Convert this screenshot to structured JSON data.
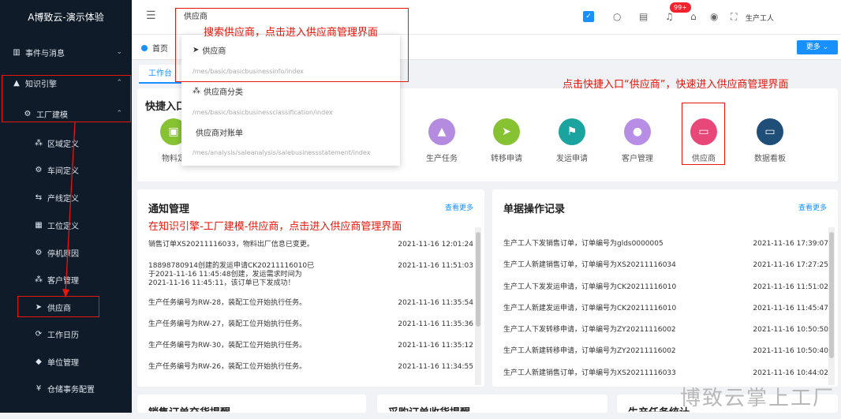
{
  "app": {
    "title": "A博致云-演示体验"
  },
  "sidebar": {
    "items": [
      {
        "label": "事件与消息",
        "icon": "chart-icon"
      },
      {
        "label": "知识引擎",
        "icon": "graduation-icon"
      },
      {
        "label": "工厂建模",
        "icon": "gear-icon"
      },
      {
        "label": "区域定义",
        "icon": "sitemap-icon"
      },
      {
        "label": "车间定义",
        "icon": "gear-icon"
      },
      {
        "label": "产线定义",
        "icon": "line-icon"
      },
      {
        "label": "工位定义",
        "icon": "grid-icon"
      },
      {
        "label": "停机原因",
        "icon": "gear-icon"
      },
      {
        "label": "客户管理",
        "icon": "sitemap-icon"
      },
      {
        "label": "供应商",
        "icon": "plane-icon"
      },
      {
        "label": "工作日历",
        "icon": "cycle-icon"
      },
      {
        "label": "单位管理",
        "icon": "badge-icon"
      },
      {
        "label": "仓储事务配置",
        "icon": "yen-icon"
      }
    ]
  },
  "topbar": {
    "search_value": "供应商",
    "badge": "99+",
    "user": "生产工人"
  },
  "tabbar": {
    "home": "首页",
    "more": "更多"
  },
  "subtab": "工作台",
  "dropdown": {
    "items": [
      {
        "label": "供应商",
        "path": "/mes/basic/basicbusinessinfo/index"
      },
      {
        "label": "供应商分类",
        "path": "/mes/basic/basicbusinessclassification/index"
      },
      {
        "label": "供应商对账单",
        "path": "/mes/analysis/saleanalysis/salebusinessstatement/index"
      }
    ]
  },
  "quick": {
    "title": "快捷入口",
    "left_label": "物料定",
    "items": [
      {
        "label": "生产任务",
        "color": "#b58be0"
      },
      {
        "label": "转移申请",
        "color": "#86c232"
      },
      {
        "label": "发运申请",
        "color": "#1ba49f"
      },
      {
        "label": "客户管理",
        "color": "#b88de6"
      },
      {
        "label": "供应商",
        "color": "#e8477a"
      },
      {
        "label": "数据看板",
        "color": "#1f4e79"
      }
    ]
  },
  "notice": {
    "title": "通知管理",
    "more": "查看更多",
    "rows": [
      {
        "text": "销售订单XS20211116033，物料出厂信息已变更。",
        "date": "2021-11-16 12:01:24"
      },
      {
        "text": "18898780914创建的发运申请CK20211116010已于2021-11-16 11:45:48创建，发运需求时间为2021-11-16 11:45:11，该订单已下发成功！",
        "date": "2021-11-16 11:51:03"
      },
      {
        "text": "生产任务编号为RW-28，装配工位开始执行任务。",
        "date": "2021-11-16 11:35:54"
      },
      {
        "text": "生产任务编号为RW-27，装配工位开始执行任务。",
        "date": "2021-11-16 11:35:36"
      },
      {
        "text": "生产任务编号为RW-30，装配工位开始执行任务。",
        "date": "2021-11-16 11:35:12"
      },
      {
        "text": "生产任务编号为RW-26，装配工位开始执行任务。",
        "date": "2021-11-16 11:34:55"
      }
    ]
  },
  "records": {
    "title": "单据操作记录",
    "more": "查看更多",
    "rows": [
      {
        "text": "生产工人下发销售订单，订单编号为glds0000005",
        "date": "2021-11-16 17:39:07"
      },
      {
        "text": "生产工人新建销售订单，订单编号为XS20211116034",
        "date": "2021-11-16 17:27:25"
      },
      {
        "text": "生产工人下发发运申请，订单编号为CK20211116010",
        "date": "2021-11-16 11:51:02"
      },
      {
        "text": "生产工人新建发运申请，订单编号为CK20211116010",
        "date": "2021-11-16 11:45:47"
      },
      {
        "text": "生产工人下发转移申请，订单编号为ZY20211116002",
        "date": "2021-11-16 10:50:50"
      },
      {
        "text": "生产工人新建转移申请，订单编号为ZY20211116002",
        "date": "2021-11-16 10:50:40"
      },
      {
        "text": "生产工人新建销售订单，订单编号为XS20211116033",
        "date": "2021-11-16 10:44:02"
      }
    ]
  },
  "bottom": [
    "销售订单交货提醒",
    "采购订单收货提醒",
    "生产任务统计"
  ],
  "annotations": {
    "search": "搜索供应商，点击进入供应商管理界面",
    "quick": "点击快捷入口“供应商”，快速进入供应商管理界面",
    "sidebar": "在知识引擎-工厂建模-供应商，点击进入供应商管理界面"
  },
  "watermark": "博致云掌上工厂"
}
